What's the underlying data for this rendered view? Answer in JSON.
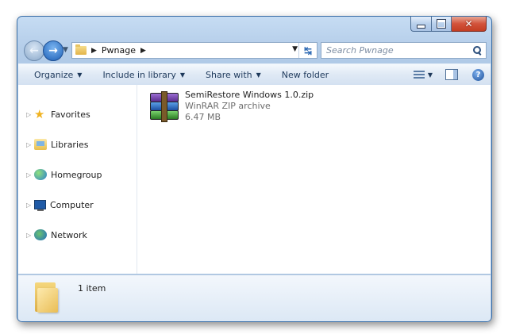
{
  "window": {
    "caption_buttons": [
      "minimize",
      "maximize",
      "close"
    ]
  },
  "address": {
    "path": [
      "Pwnage"
    ]
  },
  "search": {
    "placeholder": "Search Pwnage"
  },
  "toolbar": {
    "organize": "Organize",
    "include_in_library": "Include in library",
    "share_with": "Share with",
    "new_folder": "New folder",
    "icons": [
      "views-icon",
      "preview-pane-icon",
      "help-icon"
    ]
  },
  "sidebar": {
    "items": [
      {
        "label": "Favorites",
        "icon": "star-icon"
      },
      {
        "label": "Libraries",
        "icon": "libraries-icon"
      },
      {
        "label": "Homegroup",
        "icon": "homegroup-icon"
      },
      {
        "label": "Computer",
        "icon": "computer-icon"
      },
      {
        "label": "Network",
        "icon": "network-icon"
      }
    ]
  },
  "files": [
    {
      "name": "SemiRestore Windows 1.0.zip",
      "type": "WinRAR ZIP archive",
      "size": "6.47 MB",
      "icon": "winrar-archive-icon"
    }
  ],
  "details": {
    "count": "1 item"
  }
}
